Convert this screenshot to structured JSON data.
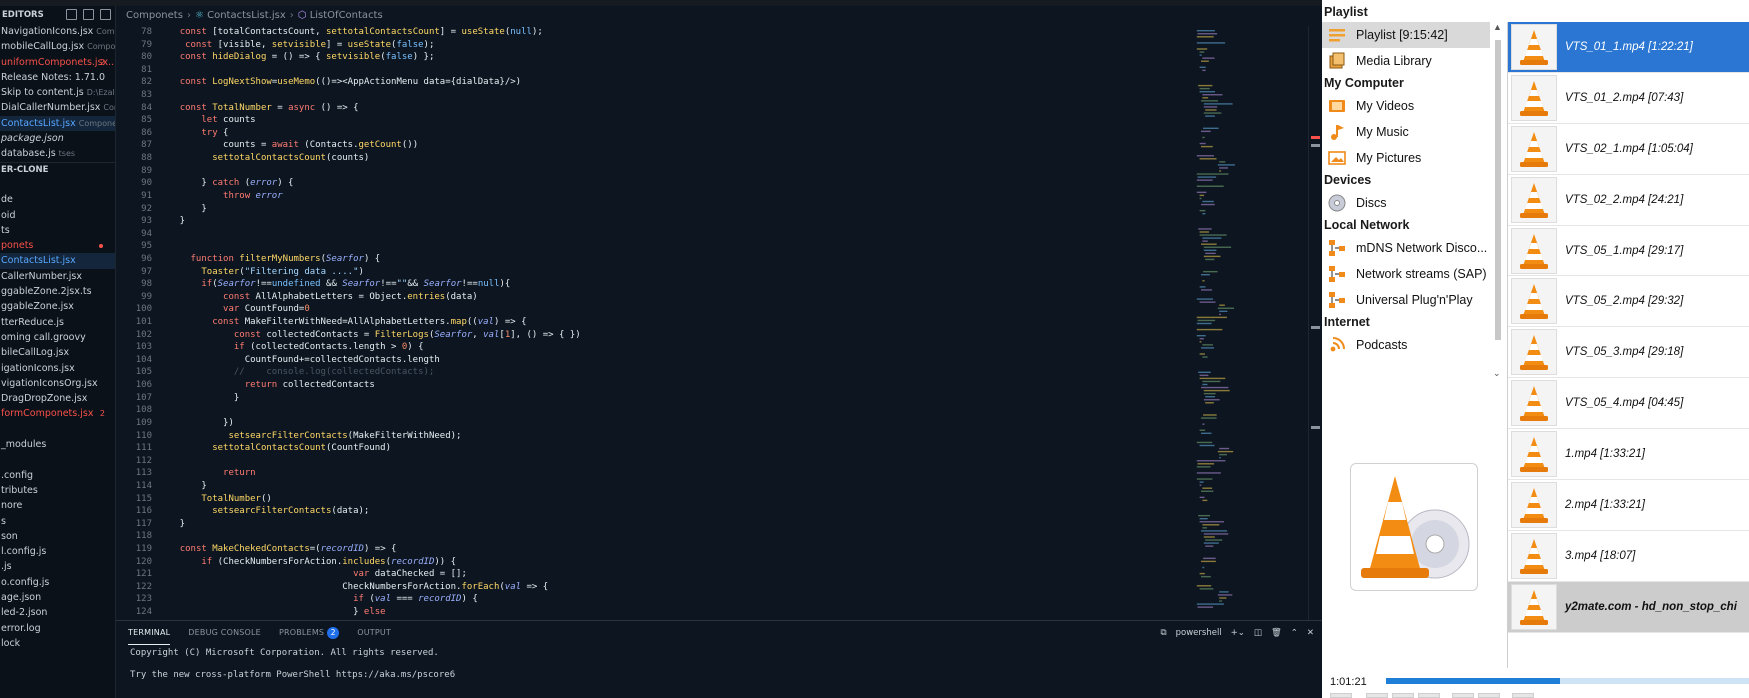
{
  "explorer": {
    "open_editors_header": "EDITORS",
    "open_editors": [
      {
        "name": "NavigationIcons.jsx",
        "sub": "Compo...",
        "style": "normal"
      },
      {
        "name": "mobileCallLog.jsx",
        "sub": "Componets",
        "style": "normal"
      },
      {
        "name": "uniformComponets.jsx...",
        "sub": "",
        "badge": "2",
        "style": "err"
      },
      {
        "name": "Release Notes: 1.71.0",
        "sub": "",
        "style": "normal"
      },
      {
        "name": "Skip to content.js",
        "sub": "D:\\Ezala...",
        "style": "normal"
      },
      {
        "name": "DialCallerNumber.jsx",
        "sub": "Comp...",
        "style": "normal"
      },
      {
        "name": "ContactsList.jsx",
        "sub": "Componets",
        "style": "sel"
      },
      {
        "name": "package.json",
        "sub": "",
        "style": "italic"
      },
      {
        "name": "database.js",
        "sub": "tses",
        "style": "normal"
      }
    ],
    "project_header": "ER-CLONE",
    "files": [
      {
        "name": "",
        "style": "normal"
      },
      {
        "name": "de",
        "style": "normal"
      },
      {
        "name": "oid",
        "style": "normal"
      },
      {
        "name": "ts",
        "style": "normal"
      },
      {
        "name": "ponets",
        "style": "err",
        "dot": true
      },
      {
        "name": "ContactsList.jsx",
        "style": "sel"
      },
      {
        "name": "CallerNumber.jsx",
        "style": "normal"
      },
      {
        "name": "ggableZone.2jsx.ts",
        "style": "normal"
      },
      {
        "name": "ggableZone.jsx",
        "style": "normal"
      },
      {
        "name": "tterReduce.js",
        "style": "normal"
      },
      {
        "name": "oming call.groovy",
        "style": "normal"
      },
      {
        "name": "bileCallLog.jsx",
        "style": "normal"
      },
      {
        "name": "igationIcons.jsx",
        "style": "normal"
      },
      {
        "name": "vigationIconsOrg.jsx",
        "style": "normal"
      },
      {
        "name": "DragDropZone.jsx",
        "style": "normal"
      },
      {
        "name": "formComponets.jsx",
        "style": "err",
        "badge": "2"
      },
      {
        "name": "",
        "style": "normal"
      },
      {
        "name": "_modules",
        "style": "normal"
      },
      {
        "name": "",
        "style": "normal"
      },
      {
        "name": ".config",
        "style": "normal"
      },
      {
        "name": "tributes",
        "style": "normal"
      },
      {
        "name": "nore",
        "style": "normal"
      },
      {
        "name": "s",
        "style": "normal"
      },
      {
        "name": "son",
        "style": "normal"
      },
      {
        "name": "l.config.js",
        "style": "normal"
      },
      {
        "name": ".js",
        "style": "normal"
      },
      {
        "name": "o.config.js",
        "style": "normal"
      },
      {
        "name": "age.json",
        "style": "normal"
      },
      {
        "name": "led-2.json",
        "style": "normal"
      },
      {
        "name": "error.log",
        "style": "normal"
      },
      {
        "name": "lock",
        "style": "normal"
      }
    ]
  },
  "breadcrumb": {
    "folder": "Componets",
    "file": "ContactsList.jsx",
    "symbol": "ListOfContacts"
  },
  "editor": {
    "first_line": 78,
    "lines": [
      "    const [totalContactsCount, settotalContactsCount] = useState(null);",
      "     const [visible, setvisible] = useState(false);",
      "    const hideDialog = () => { setvisible(false) };",
      "",
      "    const LogNextShow=useMemo(()=><AppActionMenu data={dialData}/>)",
      "",
      "    const TotalNumber = async () => {",
      "        let counts",
      "        try {",
      "            counts = await (Contacts.getCount())",
      "          settotalContactsCount(counts)",
      "",
      "        } catch (error) {",
      "            throw error",
      "        }",
      "    }",
      "",
      "",
      "      function filterMyNumbers(Searfor) {",
      "        Toaster(\"Filtering data ....\")",
      "        if(Searfor!==undefined && Searfor!==\"\"&& Searfor!==null){",
      "            const AllAlphabetLetters = Object.entries(data)",
      "            var CountFound=0",
      "          const MakeFilterWithNeed=AllAlphabetLetters.map((val) => {",
      "              const collectedContacts = FilterLogs(Searfor, val[1], () => { })",
      "              if (collectedContacts.length > 0) {",
      "                CountFound+=collectedContacts.length",
      "              //    console.log(collectedContacts);",
      "                return collectedContacts",
      "              }",
      "",
      "            })",
      "             setsearcFilterContacts(MakeFilterWithNeed);",
      "          settotalContactsCount(CountFound)",
      "",
      "            return",
      "        }",
      "        TotalNumber()",
      "          setsearcFilterContacts(data);",
      "    }",
      "",
      "    const MakeChekedContacts=(recordID) => {",
      "        if (CheckNumbersForAction.includes(recordID)) {",
      "                                    var dataChecked = [];",
      "                                  CheckNumbersForAction.forEach(val => {",
      "                                    if (val === recordID) {",
      "                                    } else"
    ]
  },
  "panel": {
    "tabs": [
      {
        "label": "TERMINAL",
        "active": true
      },
      {
        "label": "DEBUG CONSOLE",
        "active": false
      },
      {
        "label": "PROBLEMS",
        "active": false,
        "badge": "2"
      },
      {
        "label": "OUTPUT",
        "active": false
      }
    ],
    "shell_label": "powershell",
    "terminal_lines": [
      "Copyright (C) Microsoft Corporation. All rights reserved.",
      "Try the new cross-platform PowerShell https://aka.ms/pscore6"
    ]
  },
  "vlc": {
    "sidebar": [
      {
        "type": "cat",
        "label": "Playlist"
      },
      {
        "type": "item",
        "label": "Playlist [9:15:42]",
        "icon": "playlist-icon",
        "selected": true
      },
      {
        "type": "item",
        "label": "Media Library",
        "icon": "media-library-icon"
      },
      {
        "type": "cat",
        "label": "My Computer"
      },
      {
        "type": "item",
        "label": "My Videos",
        "icon": "film-icon"
      },
      {
        "type": "item",
        "label": "My Music",
        "icon": "music-note-icon"
      },
      {
        "type": "item",
        "label": "My Pictures",
        "icon": "picture-icon"
      },
      {
        "type": "cat",
        "label": "Devices"
      },
      {
        "type": "item",
        "label": "Discs",
        "icon": "disc-icon"
      },
      {
        "type": "cat",
        "label": "Local Network"
      },
      {
        "type": "item",
        "label": "mDNS Network Disco...",
        "icon": "network-icon"
      },
      {
        "type": "item",
        "label": "Network streams (SAP)",
        "icon": "network-icon"
      },
      {
        "type": "item",
        "label": "Universal Plug'n'Play",
        "icon": "network-icon"
      },
      {
        "type": "cat",
        "label": "Internet"
      },
      {
        "type": "item",
        "label": "Podcasts",
        "icon": "podcast-icon"
      }
    ],
    "playlist": [
      {
        "title": "VTS_01_1.mp4 [1:22:21]",
        "state": "selected"
      },
      {
        "title": "VTS_01_2.mp4 [07:43]",
        "state": ""
      },
      {
        "title": "VTS_02_1.mp4 [1:05:04]",
        "state": ""
      },
      {
        "title": "VTS_02_2.mp4 [24:21]",
        "state": ""
      },
      {
        "title": "VTS_05_1.mp4 [29:17]",
        "state": ""
      },
      {
        "title": "VTS_05_2.mp4 [29:32]",
        "state": ""
      },
      {
        "title": "VTS_05_3.mp4 [29:18]",
        "state": ""
      },
      {
        "title": "VTS_05_4.mp4 [04:45]",
        "state": ""
      },
      {
        "title": "1.mp4 [1:33:21]",
        "state": ""
      },
      {
        "title": "2.mp4 [1:33:21]",
        "state": ""
      },
      {
        "title": "3.mp4 [18:07]",
        "state": ""
      },
      {
        "title": "y2mate.com - hd_non_stop_chi",
        "state": "current"
      }
    ],
    "elapsed": "1:01:21",
    "progress_fraction": 0.48,
    "colors": {
      "accent": "#2a76d2",
      "seek_fill": "#1f7fd8",
      "cone_orange": "#f28c13"
    }
  }
}
